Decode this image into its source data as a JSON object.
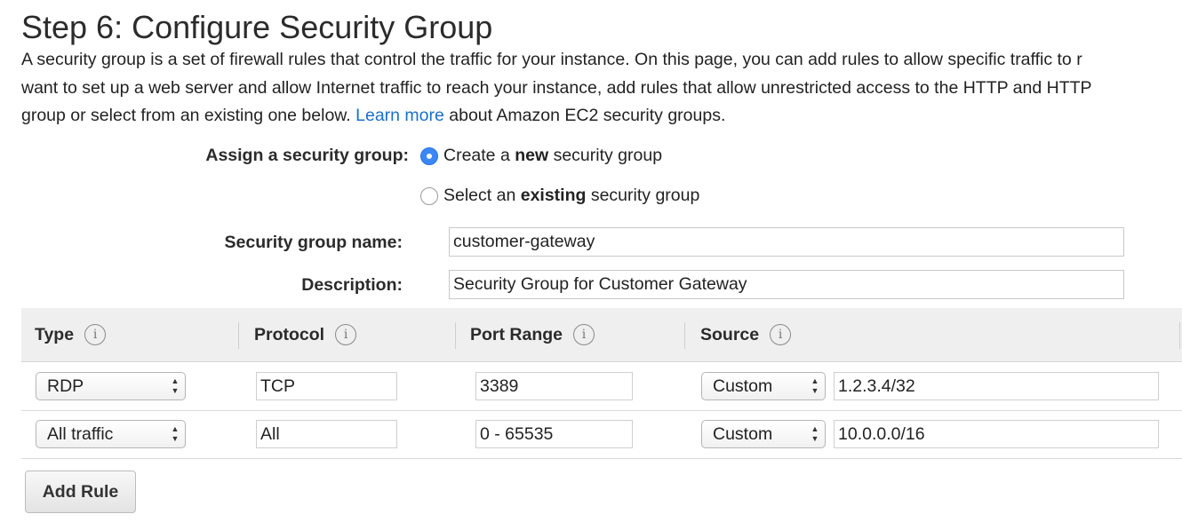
{
  "page": {
    "title": "Step 6: Configure Security Group",
    "intro_line1": "A security group is a set of firewall rules that control the traffic for your instance. On this page, you can add rules to allow specific traffic to r",
    "intro_line2": "want to set up a web server and allow Internet traffic to reach your instance, add rules that allow unrestricted access to the HTTP and HTTP",
    "intro_line3_prefix": "group or select from an existing one below. ",
    "learn_more": "Learn more",
    "intro_line3_suffix": " about Amazon EC2 security groups."
  },
  "assign": {
    "label": "Assign a security group:",
    "option_new": {
      "prefix": "Create a ",
      "bold": "new",
      "suffix": " security group",
      "selected": true
    },
    "option_existing": {
      "prefix": "Select an ",
      "bold": "existing",
      "suffix": " security group",
      "selected": false
    }
  },
  "form": {
    "name_label": "Security group name:",
    "name_value": "customer-gateway",
    "description_label": "Description:",
    "description_value": "Security Group for Customer Gateway"
  },
  "table": {
    "headers": {
      "type": "Type",
      "protocol": "Protocol",
      "port_range": "Port Range",
      "source": "Source"
    },
    "info_glyph": "i",
    "rows": [
      {
        "type": "RDP",
        "protocol": "TCP",
        "port_range": "3389",
        "source_type": "Custom",
        "source_value": "1.2.3.4/32"
      },
      {
        "type": "All traffic",
        "protocol": "All",
        "port_range": "0 - 65535",
        "source_type": "Custom",
        "source_value": "10.0.0.0/16"
      }
    ]
  },
  "actions": {
    "add_rule_label": "Add Rule"
  },
  "icons": {
    "info": "info-icon",
    "select_arrows": "updown-arrows-icon"
  },
  "colors": {
    "accent": "#3b87f5",
    "link": "#1a6fc9"
  }
}
